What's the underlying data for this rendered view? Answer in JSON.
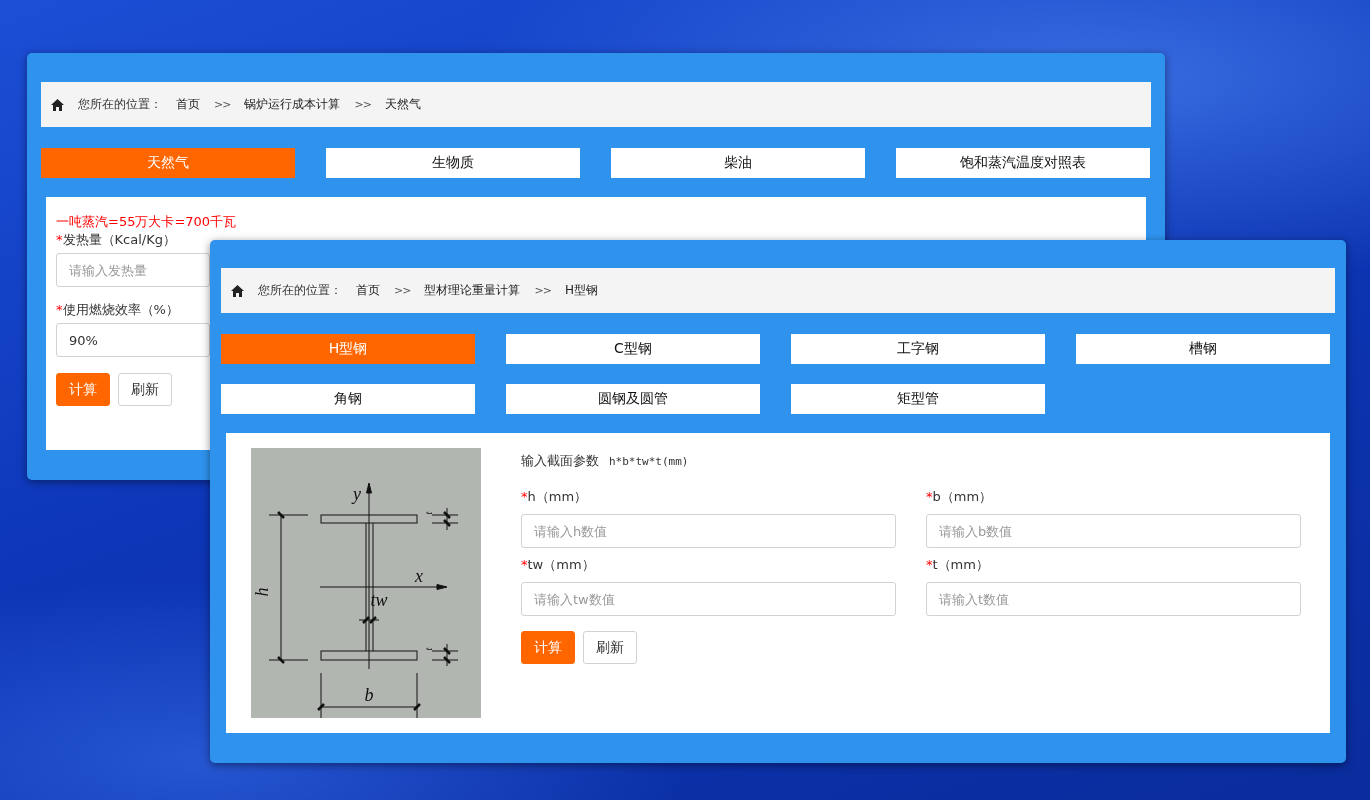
{
  "windows": [
    {
      "breadcrumb": {
        "label": "您所在的位置：",
        "path": [
          {
            "kind": "link",
            "text": "首页"
          },
          {
            "kind": "sep",
            "text": ">>"
          },
          {
            "kind": "link",
            "text": "锅炉运行成本计算"
          },
          {
            "kind": "sep",
            "text": ">>"
          },
          {
            "kind": "link",
            "text": "天然气"
          }
        ]
      },
      "tabs": [
        {
          "label": "天然气",
          "selected": true
        },
        {
          "label": "生物质",
          "selected": false
        },
        {
          "label": "柴油",
          "selected": false
        },
        {
          "label": "饱和蒸汽温度对照表",
          "selected": false
        }
      ],
      "form": {
        "kind": "simple",
        "note": "一吨蒸汽=55万大卡=700千瓦",
        "fields": [
          {
            "mark": "*",
            "label": "发热量（Kcal/Kg）",
            "placeholder": "请输入发热量"
          },
          {
            "mark": "*",
            "label": "使用燃烧效率（%）",
            "value": "90%"
          }
        ],
        "buttons": [
          {
            "label": "计算",
            "kind": "primary"
          },
          {
            "label": "刷新",
            "kind": "default"
          }
        ]
      }
    },
    {
      "breadcrumb": {
        "label": "您所在的位置：",
        "path": [
          {
            "kind": "link",
            "text": "首页"
          },
          {
            "kind": "sep",
            "text": ">>"
          },
          {
            "kind": "link",
            "text": "型材理论重量计算"
          },
          {
            "kind": "sep",
            "text": ">>"
          },
          {
            "kind": "link",
            "text": "H型钢"
          }
        ]
      },
      "tabs": [
        {
          "label": "H型钢",
          "selected": true
        },
        {
          "label": "C型钢",
          "selected": false
        },
        {
          "label": "工字钢",
          "selected": false
        },
        {
          "label": "槽钢",
          "selected": false
        },
        {
          "label": "角钢",
          "selected": false
        },
        {
          "label": "圆钢及圆管",
          "selected": false
        },
        {
          "label": "矩型管",
          "selected": false
        }
      ],
      "form": {
        "kind": "section",
        "title": "输入截面参数",
        "hint": "h*b*tw*t(mm)",
        "diagram": {
          "labels": [
            "y",
            "x",
            "h",
            "tw",
            "b",
            "t",
            "t"
          ]
        },
        "fields": [
          {
            "mark": "*",
            "label": "h（mm）",
            "placeholder": "请输入h数值"
          },
          {
            "mark": "*",
            "label": "b（mm）",
            "placeholder": "请输入b数值"
          },
          {
            "mark": "*",
            "label": "tw（mm）",
            "placeholder": "请输入tw数值"
          },
          {
            "mark": "*",
            "label": "t（mm）",
            "placeholder": "请输入t数值"
          }
        ],
        "buttons": [
          {
            "label": "计算",
            "kind": "primary"
          },
          {
            "label": "刷新",
            "kind": "default"
          }
        ]
      }
    }
  ]
}
